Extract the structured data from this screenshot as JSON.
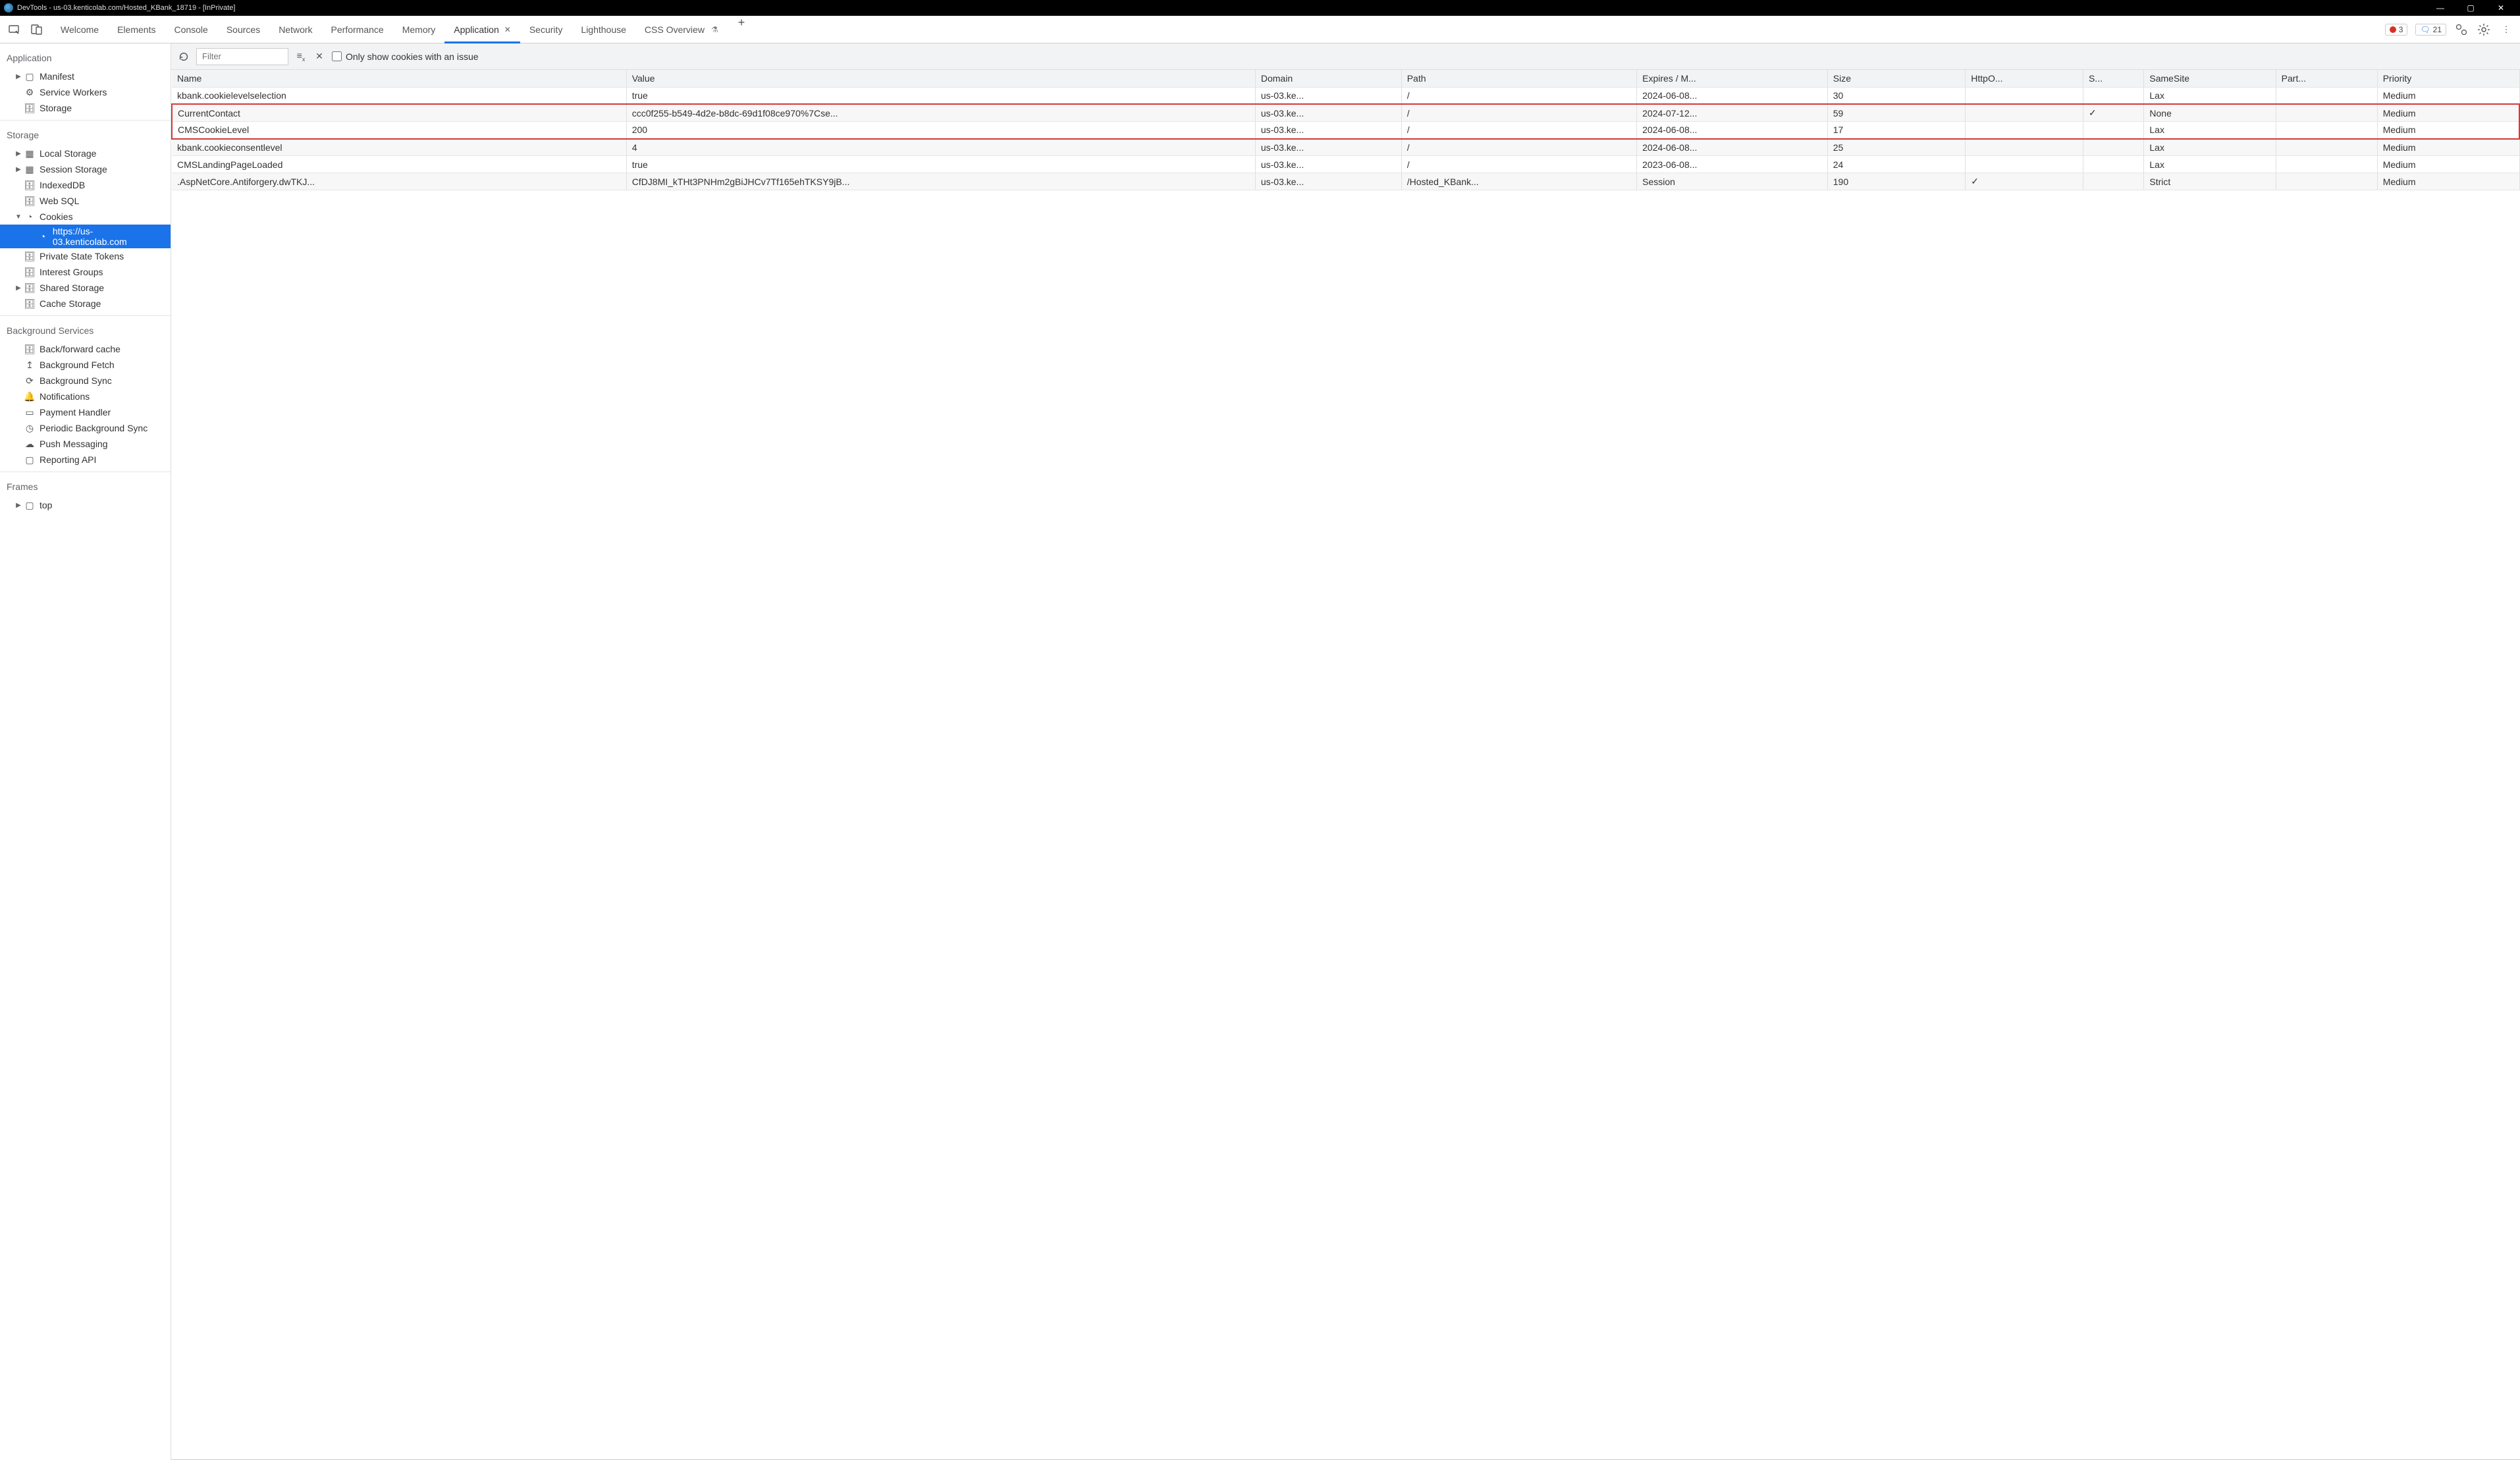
{
  "title": "DevTools - us-03.kenticolab.com/Hosted_KBank_18719 - [InPrivate]",
  "tabs": {
    "welcome": "Welcome",
    "elements": "Elements",
    "console": "Console",
    "sources": "Sources",
    "network": "Network",
    "performance": "Performance",
    "memory": "Memory",
    "application": "Application",
    "security": "Security",
    "lighthouse": "Lighthouse",
    "cssoverview": "CSS Overview"
  },
  "counts": {
    "errors": "3",
    "messages": "21"
  },
  "sidebar": {
    "application_h": "Application",
    "storage_h": "Storage",
    "bg_h": "Background Services",
    "frames_h": "Frames",
    "manifest": "Manifest",
    "service_workers": "Service Workers",
    "storage": "Storage",
    "local_storage": "Local Storage",
    "session_storage": "Session Storage",
    "indexeddb": "IndexedDB",
    "websql": "Web SQL",
    "cookies": "Cookies",
    "cookies_origin": "https://us-03.kenticolab.com",
    "pst": "Private State Tokens",
    "interest_groups": "Interest Groups",
    "shared_storage": "Shared Storage",
    "cache_storage": "Cache Storage",
    "bf_cache": "Back/forward cache",
    "bg_fetch": "Background Fetch",
    "bg_sync": "Background Sync",
    "notifications": "Notifications",
    "payment": "Payment Handler",
    "periodic_bg": "Periodic Background Sync",
    "push": "Push Messaging",
    "reporting": "Reporting API",
    "top": "top"
  },
  "filter": {
    "placeholder": "Filter",
    "only_issue": "Only show cookies with an issue"
  },
  "columns": {
    "name": "Name",
    "value": "Value",
    "domain": "Domain",
    "path": "Path",
    "expires": "Expires / M...",
    "size": "Size",
    "httponly": "HttpO...",
    "secure": "S...",
    "samesite": "SameSite",
    "partition": "Part...",
    "priority": "Priority"
  },
  "rows": [
    {
      "name": "kbank.cookielevelselection",
      "value": "true",
      "domain": "us-03.ke...",
      "path": "/",
      "expires": "2024-06-08...",
      "size": "30",
      "httponly": "",
      "secure": "",
      "samesite": "Lax",
      "partition": "",
      "priority": "Medium",
      "hl": false
    },
    {
      "name": "CurrentContact",
      "value": "ccc0f255-b549-4d2e-b8dc-69d1f08ce970%7Cse...",
      "domain": "us-03.ke...",
      "path": "/",
      "expires": "2024-07-12...",
      "size": "59",
      "httponly": "",
      "secure": "✓",
      "samesite": "None",
      "partition": "",
      "priority": "Medium",
      "hl": "top"
    },
    {
      "name": "CMSCookieLevel",
      "value": "200",
      "domain": "us-03.ke...",
      "path": "/",
      "expires": "2024-06-08...",
      "size": "17",
      "httponly": "",
      "secure": "",
      "samesite": "Lax",
      "partition": "",
      "priority": "Medium",
      "hl": "bot"
    },
    {
      "name": "kbank.cookieconsentlevel",
      "value": "4",
      "domain": "us-03.ke...",
      "path": "/",
      "expires": "2024-06-08...",
      "size": "25",
      "httponly": "",
      "secure": "",
      "samesite": "Lax",
      "partition": "",
      "priority": "Medium",
      "hl": false
    },
    {
      "name": "CMSLandingPageLoaded",
      "value": "true",
      "domain": "us-03.ke...",
      "path": "/",
      "expires": "2023-06-08...",
      "size": "24",
      "httponly": "",
      "secure": "",
      "samesite": "Lax",
      "partition": "",
      "priority": "Medium",
      "hl": false
    },
    {
      "name": ".AspNetCore.Antiforgery.dwTKJ...",
      "value": "CfDJ8MI_kTHt3PNHm2gBiJHCv7Tf165ehTKSY9jB...",
      "domain": "us-03.ke...",
      "path": "/Hosted_KBank...",
      "expires": "Session",
      "size": "190",
      "httponly": "✓",
      "secure": "",
      "samesite": "Strict",
      "partition": "",
      "priority": "Medium",
      "hl": false
    }
  ]
}
